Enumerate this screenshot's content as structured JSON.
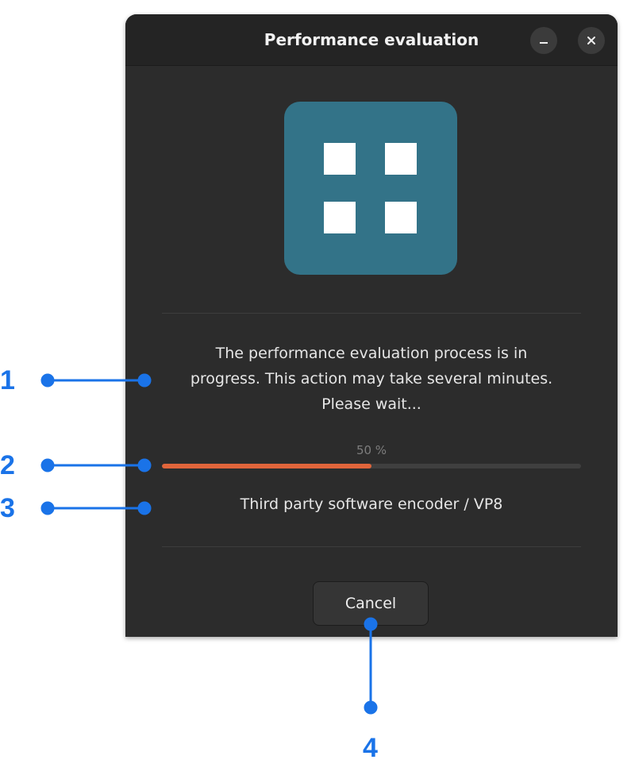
{
  "dialog": {
    "title": "Performance evaluation",
    "minimize_icon": "minimize-icon",
    "close_icon": "close-icon",
    "app_icon": "app-grid-icon",
    "app_icon_color": "#337388",
    "message": "The performance evaluation process is in\nprogress. This action may take several minutes.\nPlease wait...",
    "progress": {
      "percent_label": "50 %",
      "value": 0.5,
      "fill_color": "#e0653b"
    },
    "status": "Third party software encoder / VP8",
    "cancel_label": "Cancel"
  },
  "callouts": {
    "accent_color": "#1a73e8",
    "labels": [
      "1",
      "2",
      "3",
      "4"
    ]
  }
}
